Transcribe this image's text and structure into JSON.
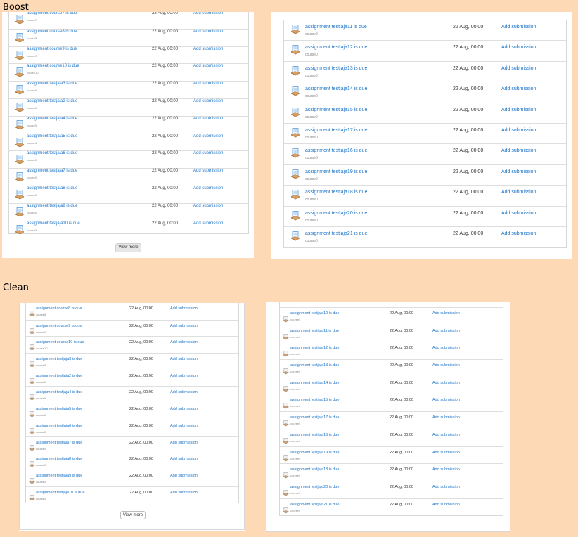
{
  "labels": {
    "boost": "Boost",
    "clean": "Clean"
  },
  "boost_left": {
    "rows": [
      {
        "title": "assignment course7 is due",
        "course": "course7",
        "date": "22 Aug, 00:00",
        "action": "Add submission"
      },
      {
        "title": "assignment course8 is due",
        "course": "course8",
        "date": "22 Aug, 00:00",
        "action": "Add submission"
      },
      {
        "title": "assignment course9 is due",
        "course": "course9",
        "date": "22 Aug, 00:00",
        "action": "Add submission"
      },
      {
        "title": "assignment course10 is due",
        "course": "course10",
        "date": "22 Aug, 00:00",
        "action": "Add submission"
      },
      {
        "title": "assignment testjaja3 is due",
        "course": "course0",
        "date": "22 Aug, 00:00",
        "action": "Add submission"
      },
      {
        "title": "assignment testjaja2 is due",
        "course": "course0",
        "date": "22 Aug, 00:00",
        "action": "Add submission"
      },
      {
        "title": "assignment testjaja4 is due",
        "course": "course0",
        "date": "22 Aug, 00:00",
        "action": "Add submission"
      },
      {
        "title": "assignment testjaja5 is due",
        "course": "course0",
        "date": "22 Aug, 00:00",
        "action": "Add submission"
      },
      {
        "title": "assignment testjaja6 is due",
        "course": "course0",
        "date": "22 Aug, 00:00",
        "action": "Add submission"
      },
      {
        "title": "assignment testjaja7 is due",
        "course": "course0",
        "date": "22 Aug, 00:00",
        "action": "Add submission"
      },
      {
        "title": "assignment testjaja8 is due",
        "course": "course0",
        "date": "22 Aug, 00:00",
        "action": "Add submission"
      },
      {
        "title": "assignment testjaja9 is due",
        "course": "course0",
        "date": "22 Aug, 00:00",
        "action": "Add submission"
      },
      {
        "title": "assignment testjaja10 is due",
        "course": "course0",
        "date": "22 Aug, 00:00",
        "action": "Add submission"
      }
    ],
    "view_more": "View more"
  },
  "boost_right": {
    "rows": [
      {
        "title": "assignment testjaja11 is due",
        "course": "course0",
        "date": "22 Aug, 00:00",
        "action": "Add submission"
      },
      {
        "title": "assignment testjaja12 is due",
        "course": "course0",
        "date": "22 Aug, 00:00",
        "action": "Add submission"
      },
      {
        "title": "assignment testjaja13 is due",
        "course": "course0",
        "date": "22 Aug, 00:00",
        "action": "Add submission"
      },
      {
        "title": "assignment testjaja14 is due",
        "course": "course0",
        "date": "22 Aug, 00:00",
        "action": "Add submission"
      },
      {
        "title": "assignment testjaja15 is due",
        "course": "course0",
        "date": "22 Aug, 00:00",
        "action": "Add submission"
      },
      {
        "title": "assignment testjaja17 is due",
        "course": "course0",
        "date": "22 Aug, 00:00",
        "action": "Add submission"
      },
      {
        "title": "assignment testjaja16 is due",
        "course": "course0",
        "date": "22 Aug, 00:00",
        "action": "Add submission"
      },
      {
        "title": "assignment testjaja19 is due",
        "course": "course0",
        "date": "22 Aug, 00:00",
        "action": "Add submission"
      },
      {
        "title": "assignment testjaja18 is due",
        "course": "course0",
        "date": "22 Aug, 00:00",
        "action": "Add submission"
      },
      {
        "title": "assignment testjaja20 is due",
        "course": "course0",
        "date": "22 Aug, 00:00",
        "action": "Add submission"
      },
      {
        "title": "assignment testjaja21 is due",
        "course": "course0",
        "date": "22 Aug, 00:00",
        "action": "Add submission"
      }
    ]
  },
  "clean_left": {
    "rows": [
      {
        "title": "assignment course8 is due",
        "course": "course8",
        "date": "22 Aug, 00:00",
        "action": "Add submission"
      },
      {
        "title": "assignment course9 is due",
        "course": "course9",
        "date": "22 Aug, 00:00",
        "action": "Add submission"
      },
      {
        "title": "assignment course10 is due",
        "course": "course10",
        "date": "22 Aug, 00:00",
        "action": "Add submission"
      },
      {
        "title": "assignment testjaja3 is due",
        "course": "course0",
        "date": "22 Aug, 00:00",
        "action": "Add submission"
      },
      {
        "title": "assignment testjaja2 is due",
        "course": "course0",
        "date": "22 Aug, 00:00",
        "action": "Add submission"
      },
      {
        "title": "assignment testjaja4 is due",
        "course": "course0",
        "date": "22 Aug, 00:00",
        "action": "Add submission"
      },
      {
        "title": "assignment testjaja5 is due",
        "course": "course0",
        "date": "22 Aug, 00:00",
        "action": "Add submission"
      },
      {
        "title": "assignment testjaja6 is due",
        "course": "course0",
        "date": "22 Aug, 00:00",
        "action": "Add submission"
      },
      {
        "title": "assignment testjaja7 is due",
        "course": "course0",
        "date": "22 Aug, 00:00",
        "action": "Add submission"
      },
      {
        "title": "assignment testjaja8 is due",
        "course": "course0",
        "date": "22 Aug, 00:00",
        "action": "Add submission"
      },
      {
        "title": "assignment testjaja9 is due",
        "course": "course0",
        "date": "22 Aug, 00:00",
        "action": "Add submission"
      },
      {
        "title": "assignment testjaja10 is due",
        "course": "course0",
        "date": "22 Aug, 00:00",
        "action": "Add submission"
      }
    ],
    "view_more": "View more"
  },
  "clean_right": {
    "top_course": "course0",
    "rows": [
      {
        "title": "assignment testjaja10 is due",
        "course": "course0",
        "date": "22 Aug, 00:00",
        "action": "Add submission"
      },
      {
        "title": "assignment testjaja11 is due",
        "course": "course0",
        "date": "22 Aug, 00:00",
        "action": "Add submission"
      },
      {
        "title": "assignment testjaja12 is due",
        "course": "course0",
        "date": "22 Aug, 00:00",
        "action": "Add submission"
      },
      {
        "title": "assignment testjaja13 is due",
        "course": "course0",
        "date": "22 Aug, 00:00",
        "action": "Add submission"
      },
      {
        "title": "assignment testjaja14 is due",
        "course": "course0",
        "date": "22 Aug, 00:00",
        "action": "Add submission"
      },
      {
        "title": "assignment testjaja15 is due",
        "course": "course0",
        "date": "22 Aug, 00:00",
        "action": "Add submission"
      },
      {
        "title": "assignment testjaja17 is due",
        "course": "course0",
        "date": "22 Aug, 00:00",
        "action": "Add submission"
      },
      {
        "title": "assignment testjaja16 is due",
        "course": "course0",
        "date": "22 Aug, 00:00",
        "action": "Add submission"
      },
      {
        "title": "assignment testjaja19 is due",
        "course": "course0",
        "date": "22 Aug, 00:00",
        "action": "Add submission"
      },
      {
        "title": "assignment testjaja18 is due",
        "course": "course0",
        "date": "22 Aug, 00:00",
        "action": "Add submission"
      },
      {
        "title": "assignment testjaja20 is due",
        "course": "course0",
        "date": "22 Aug, 00:00",
        "action": "Add submission"
      },
      {
        "title": "assignment testjaja21 is due",
        "course": "course0",
        "date": "22 Aug, 00:00",
        "action": "Add submission"
      }
    ]
  }
}
